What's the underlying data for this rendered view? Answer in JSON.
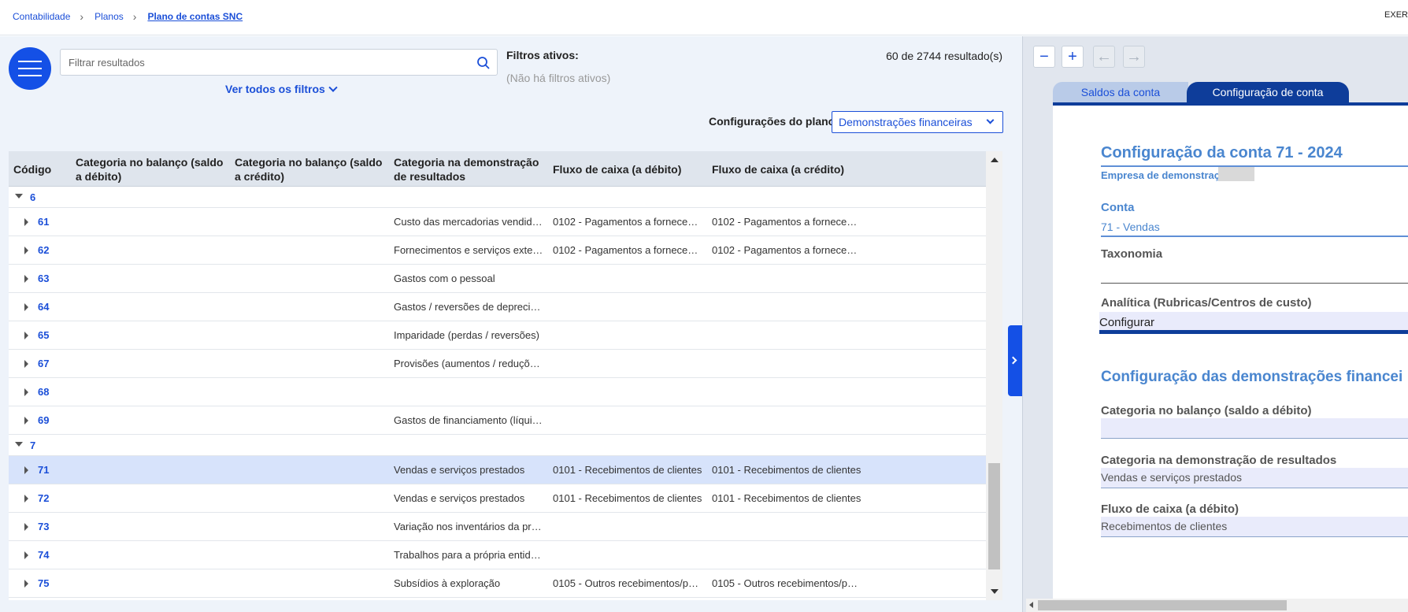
{
  "breadcrumb": [
    "Contabilidade",
    "Planos",
    "Plano de contas SNC"
  ],
  "top_right_text": "EXER",
  "search": {
    "placeholder": "Filtrar resultados",
    "value": ""
  },
  "filters": {
    "all_filters_label": "Ver todos os filtros",
    "active_title": "Filtros ativos:",
    "active_none": "(Não há filtros ativos)",
    "result_count": "60 de 2744 resultado(s)"
  },
  "plan_config": {
    "label": "Configurações do plano:",
    "selected": "Demonstrações financeiras"
  },
  "table": {
    "headers": [
      "Código",
      "Categoria no balanço (saldo a débito)",
      "Categoria no balanço (saldo a crédito)",
      "Categoria na demonstração de resultados",
      "Fluxo de caixa (a débito)",
      "Fluxo de caixa (a crédito)"
    ],
    "rows": [
      {
        "kind": "group",
        "code": "6",
        "cat_result": "",
        "flow_debit": "",
        "flow_credit": ""
      },
      {
        "kind": "item",
        "code": "61",
        "cat_result": "Custo das mercadorias vendidas e ...",
        "flow_debit": "0102 - Pagamentos a fornecedores",
        "flow_credit": "0102 - Pagamentos a fornecedores"
      },
      {
        "kind": "item",
        "code": "62",
        "cat_result": "Fornecimentos e serviços externos",
        "flow_debit": "0102 - Pagamentos a fornecedores",
        "flow_credit": "0102 - Pagamentos a fornecedores"
      },
      {
        "kind": "item",
        "code": "63",
        "cat_result": "Gastos com o pessoal",
        "flow_debit": "",
        "flow_credit": ""
      },
      {
        "kind": "item",
        "code": "64",
        "cat_result": "Gastos / reversões de depreciação ...",
        "flow_debit": "",
        "flow_credit": ""
      },
      {
        "kind": "item",
        "code": "65",
        "cat_result": "Imparidade (perdas / reversões)",
        "flow_debit": "",
        "flow_credit": ""
      },
      {
        "kind": "item",
        "code": "67",
        "cat_result": "Provisões (aumentos / reduções)",
        "flow_debit": "",
        "flow_credit": ""
      },
      {
        "kind": "item",
        "code": "68",
        "cat_result": "",
        "flow_debit": "",
        "flow_credit": ""
      },
      {
        "kind": "item",
        "code": "69",
        "cat_result": "Gastos de financiamento (líquidos)",
        "flow_debit": "",
        "flow_credit": ""
      },
      {
        "kind": "group",
        "code": "7",
        "cat_result": "",
        "flow_debit": "",
        "flow_credit": ""
      },
      {
        "kind": "item",
        "code": "71",
        "selected": true,
        "cat_result": "Vendas e serviços prestados",
        "flow_debit": "0101 - Recebimentos de clientes",
        "flow_credit": "0101 - Recebimentos de clientes"
      },
      {
        "kind": "item",
        "code": "72",
        "cat_result": "Vendas e serviços prestados",
        "flow_debit": "0101 - Recebimentos de clientes",
        "flow_credit": "0101 - Recebimentos de clientes"
      },
      {
        "kind": "item",
        "code": "73",
        "cat_result": "Variação nos inventários da produç...",
        "flow_debit": "",
        "flow_credit": ""
      },
      {
        "kind": "item",
        "code": "74",
        "cat_result": "Trabalhos para a própria entidade",
        "flow_debit": "",
        "flow_credit": ""
      },
      {
        "kind": "item",
        "code": "75",
        "cat_result": "Subsídios à exploração",
        "flow_debit": "0105 - Outros recebimentos/paga...",
        "flow_credit": "0105 - Outros recebimentos/paga..."
      }
    ]
  },
  "detail": {
    "toolbar": {
      "zoom_out": "−",
      "zoom_in": "+",
      "back": "←",
      "forward": "→"
    },
    "tabs": [
      "Saldos da conta",
      "Configuração de conta"
    ],
    "title": "Configuração da conta 71 - 2024",
    "company": "Empresa de demonstração",
    "account_label": "Conta",
    "account_value": "71 - Vendas",
    "taxonomy_label": "Taxonomia",
    "analytics_label": "Analítica (Rubricas/Centros de custo)",
    "analytics_value": "Configurar",
    "section_title": "Configuração das demonstrações financei",
    "balance_debit_label": "Categoria no balanço (saldo a débito)",
    "balance_debit_value": "",
    "result_cat_label": "Categoria na demonstração de resultados",
    "result_cat_value": "Vendas e serviços prestados",
    "flow_debit_label": "Fluxo de caixa (a débito)",
    "flow_debit_value": "Recebimentos de clientes"
  },
  "colors": {
    "accent": "#1450e6",
    "link": "#1b4fd8",
    "dark_tab": "#0e3d9a",
    "detail_text": "#4a86cf",
    "selected_row": "#d7e3fb"
  }
}
